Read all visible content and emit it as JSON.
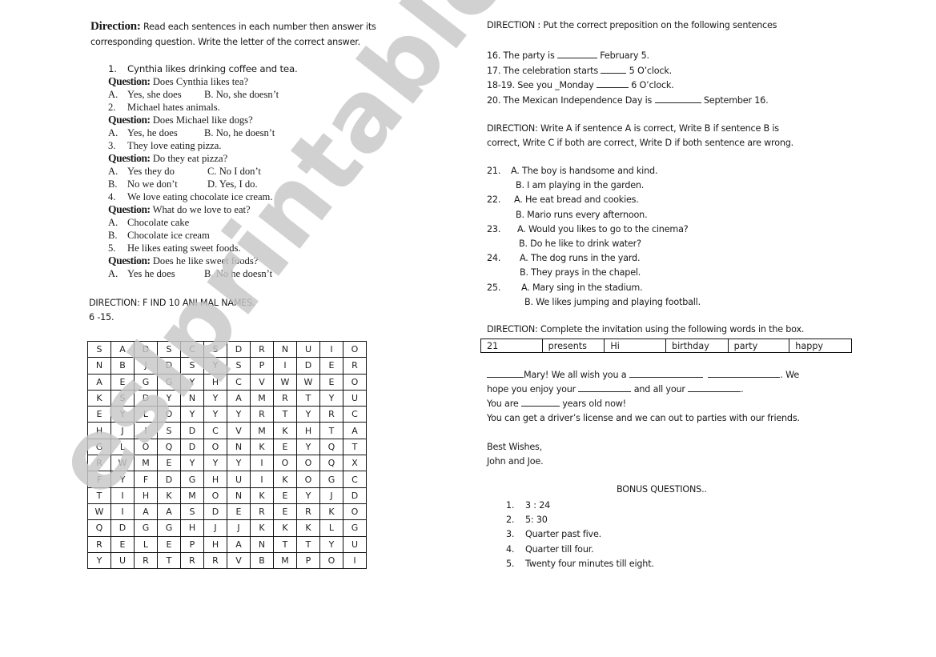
{
  "left": {
    "direction1": {
      "label": "Direction:",
      "text_line1": " Read  each sentences in each number then answer its",
      "text_line2": "corresponding question. Write the letter of the correct answer."
    },
    "questions": [
      {
        "number": "1.",
        "sentence": "Cynthia likes drinking coffee and tea.",
        "question_label": "Question:",
        "question": "Does Cynthia likes tea?",
        "options": [
          [
            "A.",
            "Yes, she does",
            "B. No, she doesn’t"
          ]
        ]
      },
      {
        "number": "2.",
        "sentence": "Michael hates animals.",
        "question_label": "Question:",
        "question": "Does Michael like dogs?",
        "options": [
          [
            "A.",
            "Yes, he does",
            "B. No, he doesn’t"
          ]
        ]
      },
      {
        "number": "3.",
        "sentence": "They  love eating pizza.",
        "question_label": "Question:",
        "question": "Do they eat pizza?",
        "options": [
          [
            "A.",
            "Yes they do",
            "C. No I don’t"
          ],
          [
            "B.",
            "No we don’t",
            "D. Yes, I do."
          ]
        ]
      },
      {
        "number": "4.",
        "sentence": "We love eating chocolate ice cream.",
        "question_label": "Question:",
        "question": "What do we love to eat?",
        "options": [
          [
            "A.",
            "Chocolate cake",
            ""
          ],
          [
            "B.",
            "Chocolate ice cream",
            ""
          ]
        ]
      },
      {
        "number": "5.",
        "sentence": "He likes eating sweet foods.",
        "question_label": "Question:",
        "question": "Does he like sweet foods?",
        "options": [
          [
            "A.",
            "Yes he does",
            "B. No he doesn’t"
          ]
        ]
      }
    ],
    "direction2": "DIRECTION: F IND 10 ANI MAL NAMES.",
    "range": "6 -15.",
    "word_search": [
      [
        "S",
        "A",
        "D",
        "S",
        "C",
        "S",
        "D",
        "R",
        "N",
        "U",
        "I",
        "O"
      ],
      [
        "N",
        "B",
        "J",
        "D",
        "S",
        "Y",
        "S",
        "P",
        "I",
        "D",
        "E",
        "R"
      ],
      [
        "A",
        "E",
        "G",
        "G",
        "Y",
        "H",
        "C",
        "V",
        "W",
        "W",
        "E",
        "O"
      ],
      [
        "K",
        "S",
        "D",
        "Y",
        "N",
        "Y",
        "A",
        "M",
        "R",
        "T",
        "Y",
        "U"
      ],
      [
        "E",
        "Y",
        "L",
        "O",
        "Y",
        "Y",
        "Y",
        "R",
        "T",
        "Y",
        "R",
        "C"
      ],
      [
        "H",
        "J",
        "I",
        "S",
        "D",
        "C",
        "V",
        "M",
        "K",
        "H",
        "T",
        "A"
      ],
      [
        "G",
        "L",
        "O",
        "Q",
        "D",
        "O",
        "N",
        "K",
        "E",
        "Y",
        "Q",
        "T"
      ],
      [
        "R",
        "W",
        "M",
        "E",
        "Y",
        "Y",
        "Y",
        "I",
        "O",
        "O",
        "Q",
        "X"
      ],
      [
        "F",
        "Y",
        "F",
        "D",
        "G",
        "H",
        "U",
        "I",
        "K",
        "O",
        "G",
        "C"
      ],
      [
        "T",
        "I",
        "H",
        "K",
        "M",
        "O",
        "N",
        "K",
        "E",
        "Y",
        "J",
        "D"
      ],
      [
        "W",
        "I",
        "A",
        "A",
        "S",
        "D",
        "E",
        "R",
        "E",
        "R",
        "K",
        "O"
      ],
      [
        "Q",
        "D",
        "G",
        "G",
        "H",
        "J",
        "J",
        "K",
        "K",
        "K",
        "L",
        "G"
      ],
      [
        "R",
        "E",
        "L",
        "E",
        "P",
        "H",
        "A",
        "N",
        "T",
        "T",
        "Y",
        "U"
      ],
      [
        "Y",
        "U",
        "R",
        "T",
        "R",
        "R",
        "V",
        "B",
        "M",
        "P",
        "O",
        "I"
      ]
    ]
  },
  "right": {
    "direction3": "DIRECTION : Put the correct preposition on the following sentences",
    "prepositions": [
      {
        "pre": "16. The party is ",
        "post": " February 5."
      },
      {
        "pre": "17.  The celebration starts ",
        "post": "  5 O’clock."
      },
      {
        "pre": "18-19. See you _Monday ",
        "post": " 6 O’clock."
      },
      {
        "pre": "20. The Mexican Independence Day is ",
        "post": " September 16."
      }
    ],
    "direction4_line1": "DIRECTION:  Write A if sentence A is correct,  Write B if sentence B is",
    "direction4_line2": "correct,  Write C if both are correct,  Write D  if both sentence are wrong.",
    "pairs": [
      {
        "number": "21.",
        "a": "A. The boy is handsome and kind.",
        "b": "B.  I am playing in the garden."
      },
      {
        "number": "22.",
        "a": "A. He eat bread and cookies.",
        "b": "B.  Mario runs every afternoon."
      },
      {
        "number": "23.",
        "a": "A. Would you likes to go to the cinema?",
        "b": "B.  Do he like to drink water?"
      },
      {
        "number": "24.",
        "a": "A.  The dog runs in the yard.",
        "b": "B.  They prays in the chapel."
      },
      {
        "number": "25.",
        "a": "A.  Mary  sing in the stadium.",
        "b": "B.  We likes jumping and playing football."
      }
    ],
    "direction5": "DIRECTION: Complete the invitation using the following words in the box.",
    "word_box": [
      "21",
      "presents",
      "Hi",
      "birthday",
      "party",
      "happy"
    ],
    "invitation": {
      "line1_post": "Mary!  We all wish you a ",
      "line1_end": ". We",
      "line2_pre": "hope you enjoy your ",
      "line2_mid": " and all your ",
      "line2_end": ".",
      "line3_pre": "You are ",
      "line3_post": " years old now!",
      "line4": "You can get a driver’s license and we can out to parties with our friends.",
      "closing": "Best Wishes,",
      "signature": "John and Joe."
    },
    "bonus_title": "BONUS QUESTIONS..",
    "bonus": [
      {
        "number": "1.",
        "text": "3 : 24"
      },
      {
        "number": "2.",
        "text": "5: 30"
      },
      {
        "number": "3.",
        "text": "Quarter past five."
      },
      {
        "number": "4.",
        "text": "Quarter till four."
      },
      {
        "number": "5.",
        "text": "Twenty four minutes till eight."
      }
    ]
  },
  "watermark": "eslprintables.com"
}
